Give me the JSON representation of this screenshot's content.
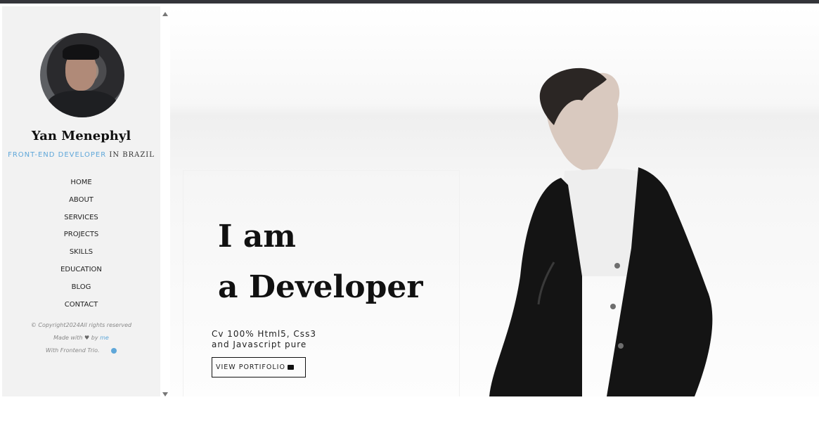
{
  "sidebar": {
    "avatar_icon": "avatar",
    "name": "Yan Menephyl",
    "role_accent": "FRONT-END DEVELOPER",
    "role_rest": "IN BRAZIL",
    "menu": [
      "HOME",
      "ABOUT",
      "SERVICES",
      "PROJECTS",
      "SKILLS",
      "EDUCATION",
      "BLOG",
      "CONTACT"
    ],
    "footer_line1": "© Copyright2024All rights reserved",
    "footer_made_with": "Made with",
    "footer_by": "by",
    "footer_me": "me",
    "footer_line3": "With Frontend Trio."
  },
  "hero": {
    "title_line1": "I am",
    "title_line2": "a Developer",
    "subtitle_line1": "Cv 100% Html5, Css3",
    "subtitle_line2": "and Javascript pure",
    "cta_label": "VIEW PORTIFOLIO",
    "cta_icon": "briefcase-icon"
  },
  "colors": {
    "accent": "#5fa7d9",
    "sidebar_bg": "#f2f2f2",
    "text": "#111111"
  }
}
